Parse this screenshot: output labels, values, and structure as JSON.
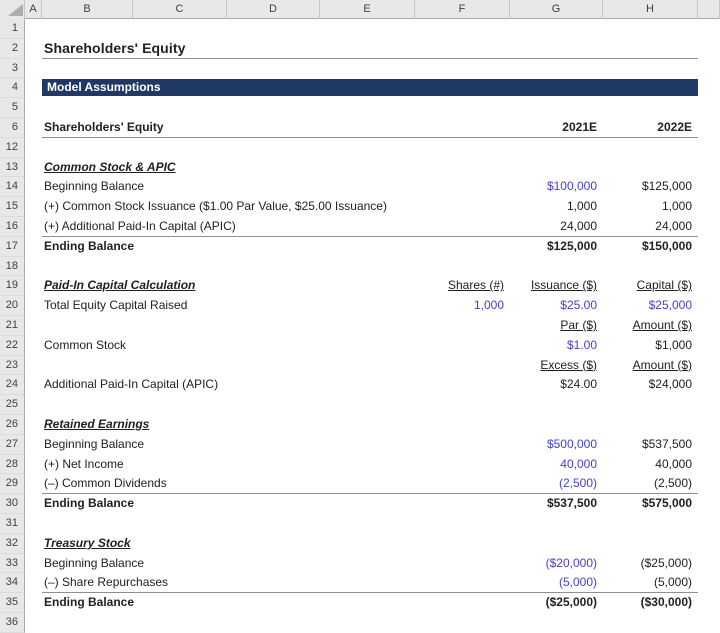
{
  "app": {
    "type": "spreadsheet",
    "title": "Shareholders' Equity",
    "banner_label": "Model Assumptions"
  },
  "colors": {
    "banner_bg": "#1F3864",
    "banner_text": "#FFFFFF",
    "input_blue": "#4343C6",
    "body_text": "#212121",
    "header_bg": "#E8E8E8"
  },
  "columns": [
    "A",
    "B",
    "C",
    "D",
    "E",
    "F",
    "G",
    "H"
  ],
  "rows": [
    {
      "num": "1",
      "cells": []
    },
    {
      "num": "2",
      "rule": true,
      "cells": [
        {
          "col": "B",
          "text": "Shareholders' Equity",
          "style": "title"
        }
      ]
    },
    {
      "num": "3",
      "cells": []
    },
    {
      "num": "4",
      "banner": "Model Assumptions",
      "cells": []
    },
    {
      "num": "5",
      "cells": []
    },
    {
      "num": "6",
      "rule": true,
      "cells": [
        {
          "col": "B",
          "text": "Shareholders' Equity",
          "bold": true
        },
        {
          "col": "G",
          "text": "2021E",
          "bold": true
        },
        {
          "col": "H",
          "text": "2022E",
          "bold": true
        }
      ]
    },
    {
      "num": "12",
      "cells": []
    },
    {
      "num": "13",
      "cells": [
        {
          "col": "B",
          "text": "Common Stock & APIC",
          "style": "section"
        }
      ]
    },
    {
      "num": "14",
      "cells": [
        {
          "col": "B",
          "text": "Beginning Balance"
        },
        {
          "col": "G",
          "text": "$100,000",
          "blue": true
        },
        {
          "col": "H",
          "text": "$125,000"
        }
      ]
    },
    {
      "num": "15",
      "cells": [
        {
          "col": "B",
          "text": "(+) Common Stock Issuance ($1.00 Par Value, $25.00 Issuance)"
        },
        {
          "col": "G",
          "text": "1,000"
        },
        {
          "col": "H",
          "text": "1,000"
        }
      ]
    },
    {
      "num": "16",
      "rule": true,
      "cells": [
        {
          "col": "B",
          "text": "(+) Additional Paid-In Capital (APIC)"
        },
        {
          "col": "G",
          "text": "24,000"
        },
        {
          "col": "H",
          "text": "24,000"
        }
      ]
    },
    {
      "num": "17",
      "cells": [
        {
          "col": "B",
          "text": "Ending Balance",
          "bold": true
        },
        {
          "col": "G",
          "text": "$125,000",
          "bold": true
        },
        {
          "col": "H",
          "text": "$150,000",
          "bold": true
        }
      ]
    },
    {
      "num": "18",
      "cells": []
    },
    {
      "num": "19",
      "cells": [
        {
          "col": "B",
          "text": "Paid-In Capital Calculation",
          "style": "section"
        },
        {
          "col": "F",
          "text": "Shares (#)",
          "underline": true
        },
        {
          "col": "G",
          "text": "Issuance ($)",
          "underline": true
        },
        {
          "col": "H",
          "text": "Capital ($)",
          "underline": true
        }
      ]
    },
    {
      "num": "20",
      "cells": [
        {
          "col": "B",
          "text": "Total Equity Capital Raised"
        },
        {
          "col": "F",
          "text": "1,000",
          "blue": true
        },
        {
          "col": "G",
          "text": "$25.00",
          "blue": true
        },
        {
          "col": "H",
          "text": "$25,000",
          "blue": true
        }
      ]
    },
    {
      "num": "21",
      "cells": [
        {
          "col": "G",
          "text": "Par ($)",
          "underline": true
        },
        {
          "col": "H",
          "text": "Amount ($)",
          "underline": true
        }
      ]
    },
    {
      "num": "22",
      "cells": [
        {
          "col": "B",
          "text": "Common Stock"
        },
        {
          "col": "G",
          "text": "$1.00",
          "blue": true
        },
        {
          "col": "H",
          "text": "$1,000"
        }
      ]
    },
    {
      "num": "23",
      "cells": [
        {
          "col": "G",
          "text": "Excess ($)",
          "underline": true
        },
        {
          "col": "H",
          "text": "Amount ($)",
          "underline": true
        }
      ]
    },
    {
      "num": "24",
      "cells": [
        {
          "col": "B",
          "text": "Additional Paid-In Capital (APIC)"
        },
        {
          "col": "G",
          "text": "$24.00"
        },
        {
          "col": "H",
          "text": "$24,000"
        }
      ]
    },
    {
      "num": "25",
      "cells": []
    },
    {
      "num": "26",
      "cells": [
        {
          "col": "B",
          "text": "Retained Earnings",
          "style": "section"
        }
      ]
    },
    {
      "num": "27",
      "cells": [
        {
          "col": "B",
          "text": "Beginning Balance"
        },
        {
          "col": "G",
          "text": "$500,000",
          "blue": true
        },
        {
          "col": "H",
          "text": "$537,500"
        }
      ]
    },
    {
      "num": "28",
      "cells": [
        {
          "col": "B",
          "text": "(+) Net Income"
        },
        {
          "col": "G",
          "text": "40,000",
          "blue": true
        },
        {
          "col": "H",
          "text": "40,000"
        }
      ]
    },
    {
      "num": "29",
      "rule": true,
      "cells": [
        {
          "col": "B",
          "text": "(–) Common Dividends"
        },
        {
          "col": "G",
          "text": "(2,500)",
          "blue": true
        },
        {
          "col": "H",
          "text": "(2,500)"
        }
      ]
    },
    {
      "num": "30",
      "cells": [
        {
          "col": "B",
          "text": "Ending Balance",
          "bold": true
        },
        {
          "col": "G",
          "text": "$537,500",
          "bold": true
        },
        {
          "col": "H",
          "text": "$575,000",
          "bold": true
        }
      ]
    },
    {
      "num": "31",
      "cells": []
    },
    {
      "num": "32",
      "cells": [
        {
          "col": "B",
          "text": "Treasury Stock",
          "style": "section"
        }
      ]
    },
    {
      "num": "33",
      "cells": [
        {
          "col": "B",
          "text": "Beginning Balance"
        },
        {
          "col": "G",
          "text": "($20,000)",
          "blue": true
        },
        {
          "col": "H",
          "text": "($25,000)"
        }
      ]
    },
    {
      "num": "34",
      "rule": true,
      "cells": [
        {
          "col": "B",
          "text": "(–) Share Repurchases"
        },
        {
          "col": "G",
          "text": "(5,000)",
          "blue": true
        },
        {
          "col": "H",
          "text": "(5,000)"
        }
      ]
    },
    {
      "num": "35",
      "cells": [
        {
          "col": "B",
          "text": "Ending Balance",
          "bold": true
        },
        {
          "col": "G",
          "text": "($25,000)",
          "bold": true
        },
        {
          "col": "H",
          "text": "($30,000)",
          "bold": true
        }
      ]
    },
    {
      "num": "36",
      "cells": []
    }
  ]
}
